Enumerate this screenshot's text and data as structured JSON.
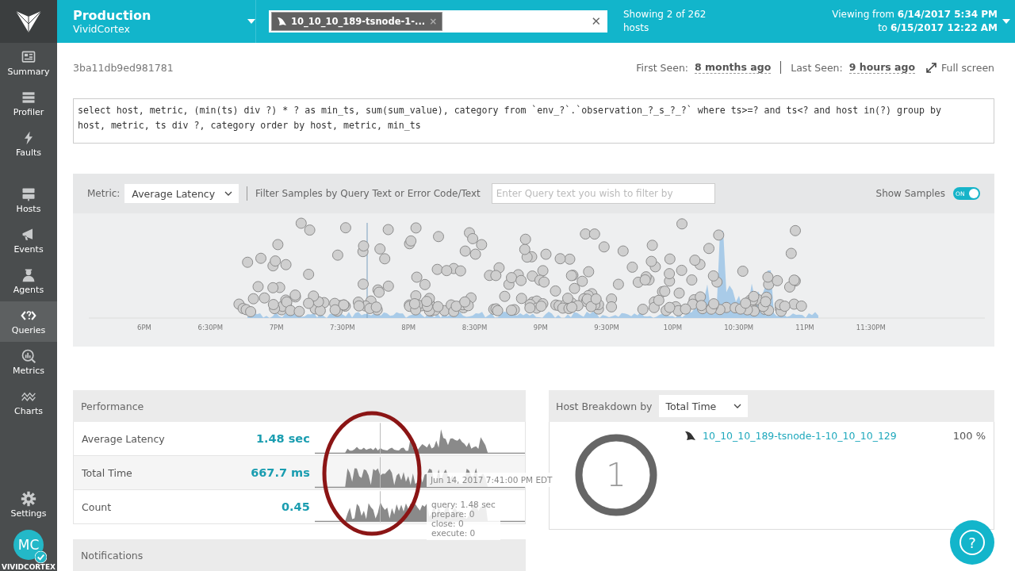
{
  "sidebar": {
    "items": [
      {
        "label": "Summary",
        "selected": false
      },
      {
        "label": "Profiler",
        "selected": false
      },
      {
        "label": "Faults",
        "selected": false
      },
      {
        "label": "Hosts",
        "selected": false
      },
      {
        "label": "Events",
        "selected": false
      },
      {
        "label": "Agents",
        "selected": false
      },
      {
        "label": "Queries",
        "selected": true
      },
      {
        "label": "Metrics",
        "selected": false
      },
      {
        "label": "Charts",
        "selected": false
      },
      {
        "label": "Settings",
        "selected": false
      }
    ],
    "avatar": {
      "initials": "MC",
      "verified": true
    },
    "footer": "VIVIDCORTEX"
  },
  "header": {
    "environment": "Production",
    "organization": "VividCortex",
    "host_filter": {
      "tag": "10_10_10_189-tsnode-1-...",
      "remove": "×",
      "clear": "✕"
    },
    "host_count": "Showing 2 of 262 hosts",
    "time_range": {
      "from_label": "Viewing from",
      "from": "6/14/2017 5:34 PM",
      "to_label": "to",
      "to": "6/15/2017 12:22 AM"
    }
  },
  "query": {
    "id": "3ba11db9ed981781",
    "first_seen_label": "First Seen:",
    "first_seen": "8 months ago",
    "last_seen_label": "Last Seen:",
    "last_seen": "9 hours ago",
    "fullscreen": "Full screen",
    "text": "select host, metric, (min(ts) div ?) * ? as min_ts, sum(sum_value), category from `env_?`.`observation_?_s_?_?` where ts>=? and ts<? and host in(?) group by host, metric, ts div ?, category order by host, metric, min_ts"
  },
  "samples": {
    "metric_label": "Metric:",
    "metric": "Average Latency",
    "filter_label": "Filter Samples by Query Text or Error Code/Text",
    "filter_placeholder": "Enter Query text you wish to filter by",
    "show_samples_label": "Show Samples",
    "show_samples": {
      "on": true,
      "label": "ON"
    },
    "time_ticks": [
      "6PM",
      "6:30PM",
      "7PM",
      "7:30PM",
      "8PM",
      "8:30PM",
      "9PM",
      "9:30PM",
      "10PM",
      "10:30PM",
      "11PM",
      "11:30PM"
    ]
  },
  "performance": {
    "title": "Performance",
    "rows": [
      {
        "label": "Average Latency",
        "value": "1.48 sec"
      },
      {
        "label": "Total Time",
        "value": "667.7 ms"
      },
      {
        "label": "Count",
        "value": "0.45"
      }
    ],
    "hover_time": "Jun 14, 2017 7:41:00 PM EDT",
    "hover_details": [
      "query: 1.48 sec",
      "prepare: 0",
      "close: 0",
      "execute: 0"
    ]
  },
  "notifications": {
    "title": "Notifications"
  },
  "host_breakdown": {
    "label": "Host Breakdown by",
    "metric": "Total Time",
    "count": "1",
    "hosts": [
      {
        "name": "10_10_10_189-tsnode-1-10_10_10_129",
        "share": "100 %"
      }
    ]
  },
  "help": {
    "label": "?"
  }
}
